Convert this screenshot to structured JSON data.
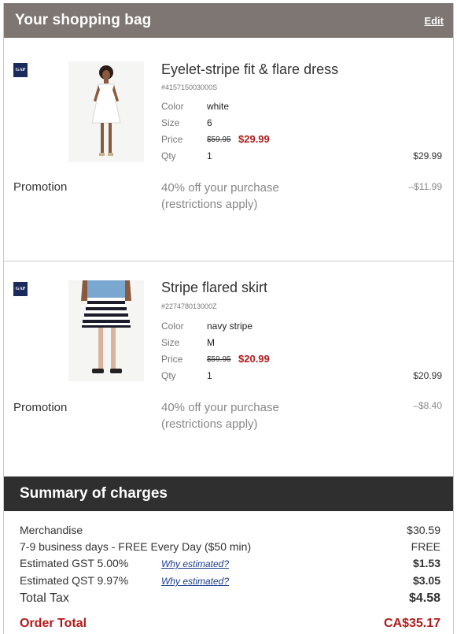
{
  "bag": {
    "title": "Your shopping bag",
    "edit_label": "Edit"
  },
  "items": [
    {
      "brand": "GAP",
      "name": "Eyelet-stripe fit & flare dress",
      "sku": "#415715003000S",
      "color_label": "Color",
      "color": "white",
      "size_label": "Size",
      "size": "6",
      "price_label": "Price",
      "old_price": "$59.95",
      "sale_price": "$29.99",
      "qty_label": "Qty",
      "qty": "1",
      "line_total": "$29.99",
      "promo_label": "Promotion",
      "promo_line1": "40% off your purchase",
      "promo_line2": "(restrictions apply)",
      "promo_amount": "–$11.99"
    },
    {
      "brand": "GAP",
      "name": "Stripe flared skirt",
      "sku": "#227478013000Z",
      "color_label": "Color",
      "color": "navy stripe",
      "size_label": "Size",
      "size": "M",
      "price_label": "Price",
      "old_price": "$59.95",
      "sale_price": "$20.99",
      "qty_label": "Qty",
      "qty": "1",
      "line_total": "$20.99",
      "promo_label": "Promotion",
      "promo_line1": "40% off your purchase",
      "promo_line2": "(restrictions apply)",
      "promo_amount": "–$8.40"
    }
  ],
  "summary": {
    "title": "Summary of charges",
    "merchandise_label": "Merchandise",
    "merchandise_value": "$30.59",
    "shipping_label": "7-9 business days - FREE Every Day ($50 min)",
    "shipping_value": "FREE",
    "gst_label": "Estimated GST 5.00%",
    "gst_link": "Why estimated?",
    "gst_value": "$1.53",
    "qst_label": "Estimated QST 9.97%",
    "qst_link": "Why estimated?",
    "qst_value": "$3.05",
    "total_tax_label": "Total Tax",
    "total_tax_value": "$4.58",
    "order_total_label": "Order Total",
    "order_total_value": "CA$35.17"
  },
  "colors": {
    "header_bg": "#7d7672",
    "summary_bg": "#2f2f2f",
    "sale_red": "#b11b1b",
    "link_blue": "#1a3c8c"
  },
  "icons": [
    "gap-logo-icon",
    "dress-product-image",
    "skirt-product-image"
  ]
}
